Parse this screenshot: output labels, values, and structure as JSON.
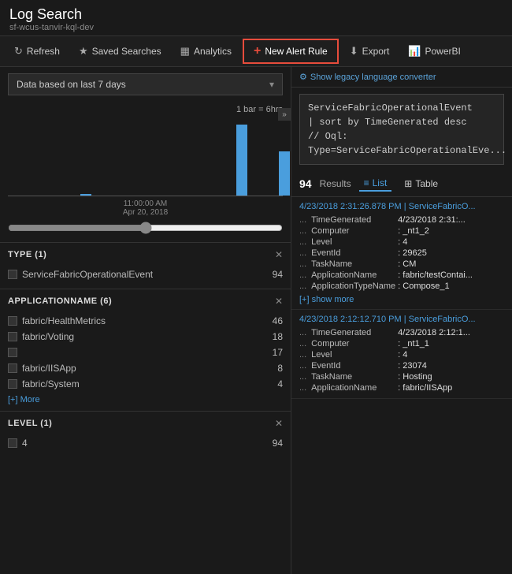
{
  "header": {
    "title": "Log Search",
    "subtitle": "sf-wcus-tanvir-kql-dev"
  },
  "toolbar": {
    "refresh_label": "Refresh",
    "saved_searches_label": "Saved Searches",
    "analytics_label": "Analytics",
    "new_alert_label": "New Alert Rule",
    "export_label": "Export",
    "powerbi_label": "PowerBI"
  },
  "left_panel": {
    "date_selector": {
      "label": "Data based on last 7 days",
      "chevron": "▾"
    },
    "chart": {
      "legend": "1 bar = 6hrs",
      "date_label": "11:00:00 AM",
      "date_label2": "Apr 20, 2018",
      "bars": [
        0,
        0,
        0,
        0,
        0,
        2,
        0,
        0,
        0,
        0,
        0,
        0,
        0,
        0,
        0,
        0,
        80,
        0,
        0,
        50,
        0,
        0,
        0,
        0
      ]
    },
    "collapse_arrow": "»",
    "type_filter": {
      "title": "TYPE  (1)",
      "items": [
        {
          "label": "ServiceFabricOperationalEvent",
          "count": 94
        }
      ]
    },
    "appname_filter": {
      "title": "APPLICATIONNAME  (6)",
      "items": [
        {
          "label": "fabric/HealthMetrics",
          "count": 46
        },
        {
          "label": "fabric/Voting",
          "count": 18
        },
        {
          "label": "",
          "count": 17
        },
        {
          "label": "fabric/IISApp",
          "count": 8
        },
        {
          "label": "fabric/System",
          "count": 4
        }
      ],
      "more_label": "[+] More"
    },
    "level_filter": {
      "title": "LEVEL  (1)",
      "items": [
        {
          "label": "4",
          "count": 94
        }
      ]
    }
  },
  "right_panel": {
    "legacy_label": "Show legacy language converter",
    "query_lines": [
      "ServiceFabricOperationalEvent",
      "| sort by TimeGenerated desc",
      "// Oql: Type=ServiceFabricOperationalEve..."
    ],
    "results_count": "94",
    "results_label": "Results",
    "view_list": "List",
    "view_table": "Table",
    "results": [
      {
        "header": "4/23/2018 2:31:26.878 PM | ServiceFabricO...",
        "fields": [
          {
            "name": "TimeGenerated",
            "value": "4/23/2018 2:31:..."
          },
          {
            "name": "Computer",
            "value": ": _nt1_2"
          },
          {
            "name": "Level",
            "value": ": 4"
          },
          {
            "name": "EventId",
            "value": ": 29625"
          },
          {
            "name": "TaskName",
            "value": ": CM"
          },
          {
            "name": "ApplicationName",
            "value": ": fabric/testContai..."
          },
          {
            "name": "ApplicationTypeName",
            "value": ": Compose_1"
          }
        ],
        "show_more": "[+] show more"
      },
      {
        "header": "4/23/2018 2:12:12.710 PM | ServiceFabricO...",
        "fields": [
          {
            "name": "TimeGenerated",
            "value": "4/23/2018 2:12:1..."
          },
          {
            "name": "Computer",
            "value": ": _nt1_1"
          },
          {
            "name": "Level",
            "value": ": 4"
          },
          {
            "name": "EventId",
            "value": ": 23074"
          },
          {
            "name": "TaskName",
            "value": ": Hosting"
          },
          {
            "name": "ApplicationName",
            "value": ": fabric/IISApp"
          }
        ]
      }
    ]
  }
}
